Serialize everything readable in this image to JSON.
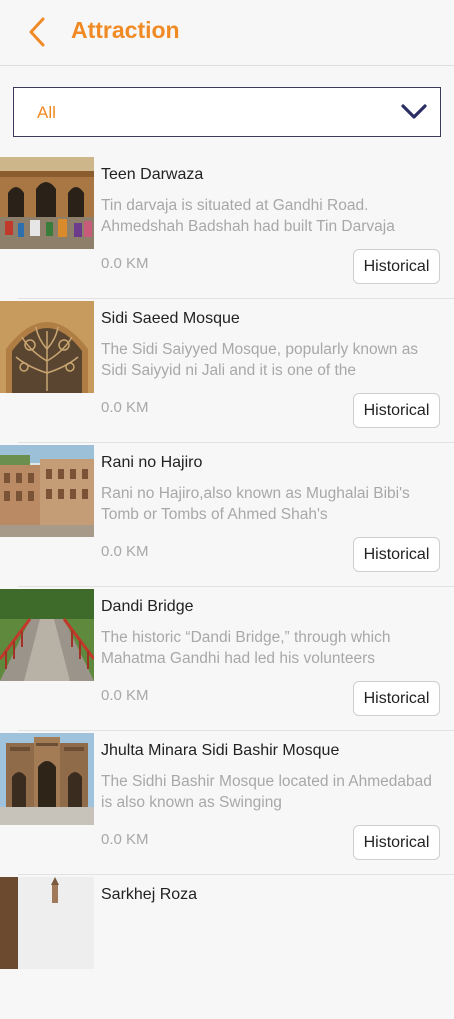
{
  "header": {
    "title": "Attraction",
    "back_icon": "chevron-left-icon"
  },
  "filter": {
    "selected": "All",
    "icon": "chevron-down-icon"
  },
  "colors": {
    "accent": "#f08a24",
    "border": "#3a3a5e"
  },
  "attractions": [
    {
      "name": "Teen Darwaza",
      "description": "Tin darvaja is situated at Gandhi Road. Ahmedshah Badshah had built Tin Darvaja",
      "distance": "0.0 KM",
      "category": "Historical"
    },
    {
      "name": "Sidi Saeed Mosque",
      "description": "The Sidi Saiyyed Mosque, popularly known as Sidi Saiyyid ni Jali and it is one of the",
      "distance": "0.0 KM",
      "category": "Historical"
    },
    {
      "name": "Rani no Hajiro",
      "description": "Rani no Hajiro,also known as Mughalai Bibi's Tomb or Tombs of Ahmed Shah's",
      "distance": "0.0 KM",
      "category": "Historical"
    },
    {
      "name": "Dandi Bridge",
      "description": "The historic “Dandi Bridge,” through which Mahatma Gandhi had led his volunteers",
      "distance": "0.0 KM",
      "category": "Historical"
    },
    {
      "name": "Jhulta Minara Sidi Bashir Mosque",
      "description": "The Sidhi Bashir Mosque located in Ahmedabad is also known as Swinging",
      "distance": "0.0 KM",
      "category": "Historical"
    },
    {
      "name": "Sarkhej Roza",
      "description": "",
      "distance": "",
      "category": ""
    }
  ]
}
